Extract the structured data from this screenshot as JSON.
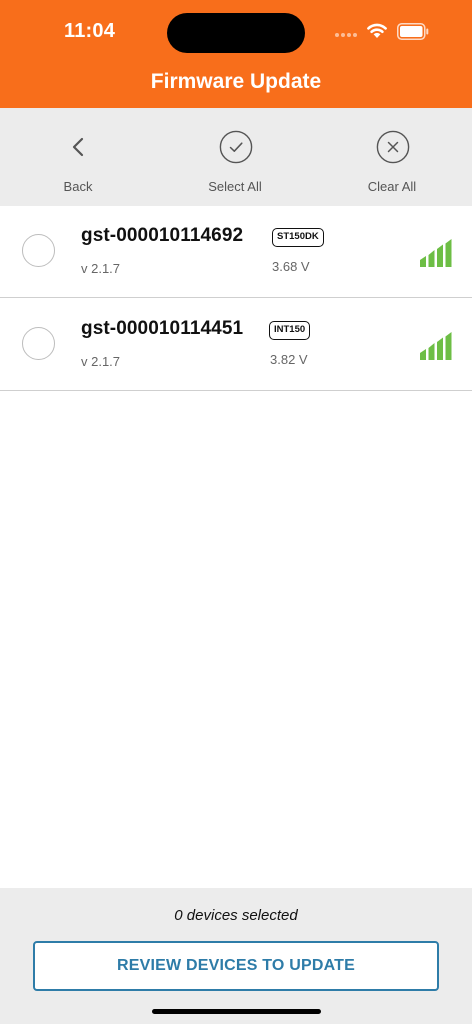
{
  "status_bar": {
    "time": "11:04"
  },
  "header": {
    "title": "Firmware Update"
  },
  "toolbar": {
    "back_label": "Back",
    "select_all_label": "Select All",
    "clear_all_label": "Clear All"
  },
  "devices": [
    {
      "name": "gst-000010114692",
      "model": "ST150DK",
      "version": "v 2.1.7",
      "voltage": "3.68 V",
      "signal_bars": 4,
      "selected": false
    },
    {
      "name": "gst-000010114451",
      "model": "INT150",
      "version": "v 2.1.7",
      "voltage": "3.82 V",
      "signal_bars": 4,
      "selected": false
    }
  ],
  "footer": {
    "selected_count": "0 devices selected",
    "review_label": "REVIEW DEVICES TO UPDATE"
  },
  "colors": {
    "brand_orange": "#F86E1B",
    "accent_blue": "#2E7CA8",
    "signal_green": "#6DBE45"
  }
}
